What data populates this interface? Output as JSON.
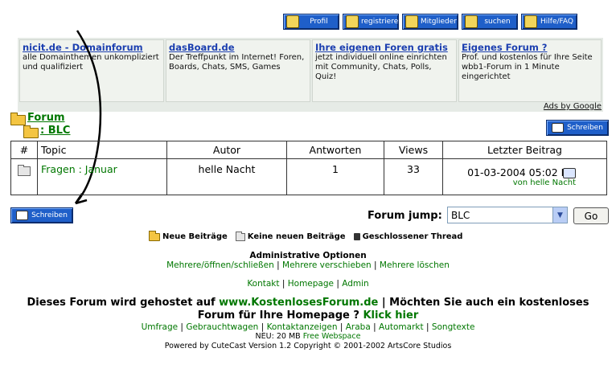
{
  "nav": [
    {
      "label": "Profil",
      "icon": "profile-icon"
    },
    {
      "label": "registrieren",
      "icon": "register-icon"
    },
    {
      "label": "Mitglieder",
      "icon": "members-icon"
    },
    {
      "label": "suchen",
      "icon": "search-icon"
    },
    {
      "label": "Hilfe/FAQ",
      "icon": "help-icon"
    }
  ],
  "ads": [
    {
      "title": "nicit.de - Domainforum",
      "desc": "alle Domainthemen unkompliziert und qualifiziert"
    },
    {
      "title": "dasBoard.de",
      "desc": "Der Treffpunkt im Internet! Foren, Boards, Chats, SMS, Games"
    },
    {
      "title": "Ihre eigenen Foren gratis",
      "desc": "jetzt individuell online einrichten mit Community, Chats, Polls, Quiz!"
    },
    {
      "title": "Eigenes Forum ?",
      "desc": "Prof. und kostenlos für Ihre Seite wbb1-Forum in 1 Minute eingerichtet"
    }
  ],
  "ads_by": "Ads by Google",
  "breadcrumb": {
    "forum": "Forum",
    "sub": ": BLC"
  },
  "write_label": "Schreiben",
  "table": {
    "headers": [
      "#",
      "Topic",
      "Autor",
      "Antworten",
      "Views",
      "Letzter Beitrag"
    ],
    "rows": [
      {
        "topic": "Fragen : Januar",
        "autor": "helle Nacht",
        "antworten": "1",
        "views": "33",
        "last_date": "01-03-2004 05:02 PM",
        "last_by_prefix": "von",
        "last_by": "helle Nacht"
      }
    ]
  },
  "forum_jump": {
    "label": "Forum jump:",
    "selected": "BLC",
    "go": "Go"
  },
  "legend": [
    "Neue Beiträge",
    "Keine neuen Beiträge",
    "Geschlossener Thread"
  ],
  "admin": {
    "title": "Administrative Optionen",
    "links": [
      "Mehrere/öffnen/schließen",
      "Mehrere verschieben",
      "Mehrere löschen"
    ]
  },
  "footer_links": [
    "Kontakt",
    "Homepage",
    "Admin"
  ],
  "hosting": {
    "prefix": "Dieses Forum wird gehostet auf",
    "site": "www.KostenlosesForum.de",
    "middle": "| Möchten Sie auch ein kostenloses",
    "line2": "Forum für Ihre Homepage ?",
    "cta": "Klick hier"
  },
  "partner_links": [
    "Umfrage",
    "Gebrauchtwagen",
    "Kontaktanzeigen",
    "Araba",
    "Automarkt",
    "Songtexte"
  ],
  "webspace": {
    "prefix": "NEU: 20 MB",
    "link": "Free Webspace"
  },
  "powered": "Powered by CuteCast Version 1.2 Copyright © 2001-2002 ArtsCore Studios",
  "colors": {
    "accent": "#1f5fc9",
    "link": "#007700",
    "ad_title": "#1c3fb0"
  }
}
